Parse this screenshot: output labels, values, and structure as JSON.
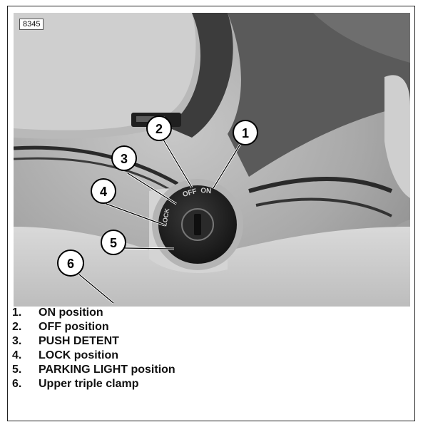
{
  "figure": {
    "id": "8345",
    "callouts": [
      "1",
      "2",
      "3",
      "4",
      "5",
      "6"
    ],
    "ignition_switch_labels": [
      "OFF",
      "ON",
      "LOCK"
    ]
  },
  "legend": [
    {
      "num": "1.",
      "text": "ON position"
    },
    {
      "num": "2.",
      "text": "OFF position"
    },
    {
      "num": "3.",
      "text": "PUSH DETENT"
    },
    {
      "num": "4.",
      "text": "LOCK position"
    },
    {
      "num": "5.",
      "text": "PARKING LIGHT position"
    },
    {
      "num": "6.",
      "text": "Upper triple clamp"
    }
  ]
}
